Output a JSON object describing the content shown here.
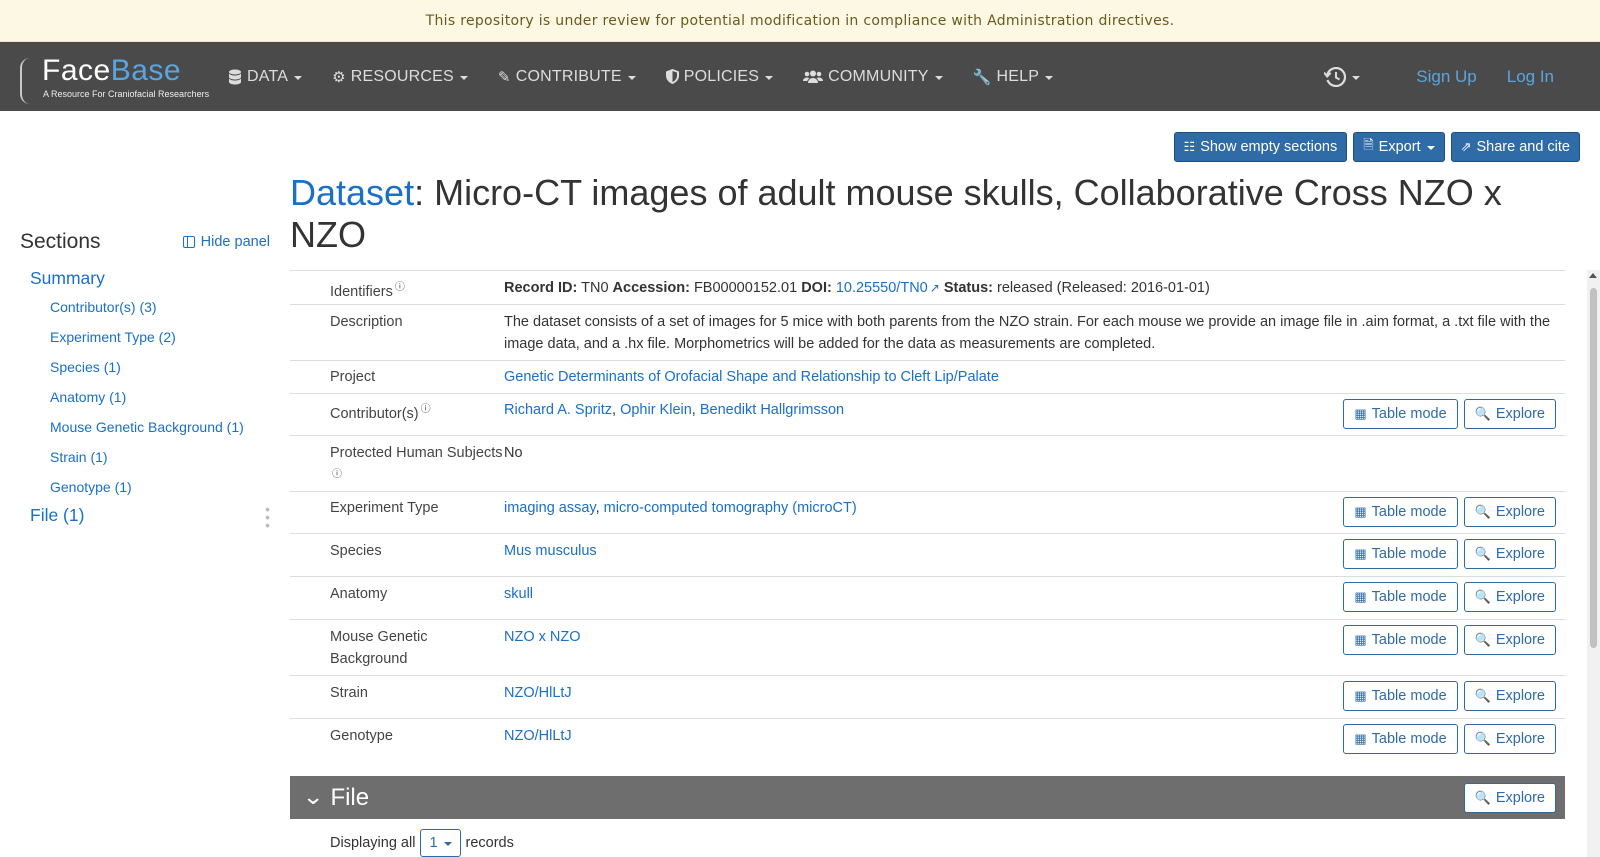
{
  "banner": {
    "text": "This repository is under review for potential modification in compliance with Administration directives."
  },
  "navbar": {
    "logo_main": "Face",
    "logo_accent": "Base",
    "logo_tagline": "A Resource For Craniofacial Researchers",
    "items": [
      {
        "label": "DATA",
        "icon": "database-icon"
      },
      {
        "label": "RESOURCES",
        "icon": "gear-icon"
      },
      {
        "label": "CONTRIBUTE",
        "icon": "edit-icon"
      },
      {
        "label": "POLICIES",
        "icon": "shield-icon"
      },
      {
        "label": "COMMUNITY",
        "icon": "users-icon"
      },
      {
        "label": "HELP",
        "icon": "wrench-icon"
      }
    ],
    "sign_up": "Sign Up",
    "log_in": "Log In"
  },
  "toolbar": {
    "show_empty": "Show empty sections",
    "export": "Export",
    "share": "Share and cite"
  },
  "title": {
    "link": "Dataset",
    "rest": ": Micro-CT images of adult mouse skulls, Collaborative Cross NZO x NZO"
  },
  "sidebar": {
    "heading": "Sections",
    "hide_panel": "Hide panel",
    "summary": "Summary",
    "items": [
      "Contributor(s) (3)",
      "Experiment Type (2)",
      "Species (1)",
      "Anatomy (1)",
      "Mouse Genetic Background (1)",
      "Strain (1)",
      "Genotype (1)"
    ],
    "file": "File (1)"
  },
  "record": {
    "identifiers_label": "Identifiers",
    "record_id_label": "Record ID:",
    "record_id": "TN0",
    "accession_label": "Accession:",
    "accession": "FB00000152.01",
    "doi_label": "DOI:",
    "doi": "10.25550/TN0",
    "status_label": "Status:",
    "status": "released (Released: 2016-01-01)",
    "description_label": "Description",
    "description": "The dataset consists of a set of images for 5 mice with both parents from the NZO strain. For each mouse we provide an image file in .aim format, a .txt file with the image data, and a .hx file. Morphometrics will be added for the data as measurements are completed.",
    "project_label": "Project",
    "project": "Genetic Determinants of Orofacial Shape and Relationship to Cleft Lip/Palate",
    "contributors_label": "Contributor(s)",
    "contributors": [
      "Richard A. Spritz",
      "Ophir Klein",
      "Benedikt Hallgrimsson"
    ],
    "protected_label": "Protected Human Subjects",
    "protected": "No",
    "experiment_label": "Experiment Type",
    "experiments": [
      "imaging assay",
      "micro-computed tomography (microCT)"
    ],
    "species_label": "Species",
    "species": "Mus musculus",
    "anatomy_label": "Anatomy",
    "anatomy": "skull",
    "mgb_label": "Mouse Genetic Background",
    "mgb": "NZO x NZO",
    "strain_label": "Strain",
    "strain": "NZO/HlLtJ",
    "genotype_label": "Genotype",
    "genotype": "NZO/HlLtJ",
    "table_mode": "Table mode",
    "explore": "Explore"
  },
  "file_section": {
    "title": "File",
    "explore": "Explore",
    "displaying": "Displaying all",
    "page_size": "1",
    "records": "records"
  },
  "colors": {
    "accent": "#1a6fc9",
    "navbar": "#4a4a4a",
    "primary_button": "#2f6ba6",
    "banner": "#fcf8e3"
  }
}
